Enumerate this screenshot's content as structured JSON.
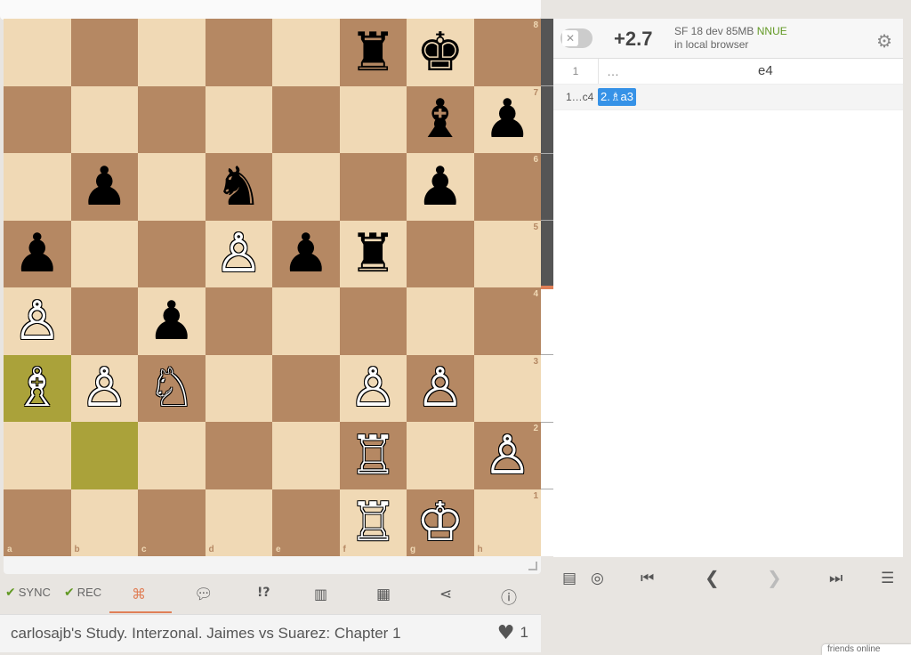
{
  "board": {
    "files": [
      "a",
      "b",
      "c",
      "d",
      "e",
      "f",
      "g",
      "h"
    ],
    "ranks": [
      "8",
      "7",
      "6",
      "5",
      "4",
      "3",
      "2",
      "1"
    ],
    "highlight_squares": [
      "a3",
      "b2"
    ],
    "colors": {
      "light": "#f0d9b5",
      "dark": "#b58863",
      "highlight": "#aaa23a"
    },
    "pieces": [
      {
        "square": "f8",
        "glyph": "♜",
        "color": "b",
        "name": "black-rook-icon"
      },
      {
        "square": "g8",
        "glyph": "♚",
        "color": "b",
        "name": "black-king-icon"
      },
      {
        "square": "g7",
        "glyph": "♝",
        "color": "b",
        "name": "black-bishop-icon"
      },
      {
        "square": "h7",
        "glyph": "♟",
        "color": "b",
        "name": "black-pawn-icon"
      },
      {
        "square": "b6",
        "glyph": "♟",
        "color": "b",
        "name": "black-pawn-icon"
      },
      {
        "square": "d6",
        "glyph": "♞",
        "color": "b",
        "name": "black-knight-icon"
      },
      {
        "square": "g6",
        "glyph": "♟",
        "color": "b",
        "name": "black-pawn-icon"
      },
      {
        "square": "a5",
        "glyph": "♟",
        "color": "b",
        "name": "black-pawn-icon"
      },
      {
        "square": "d5",
        "glyph": "♙",
        "color": "w",
        "name": "white-pawn-icon"
      },
      {
        "square": "e5",
        "glyph": "♟",
        "color": "b",
        "name": "black-pawn-icon"
      },
      {
        "square": "f5",
        "glyph": "♜",
        "color": "b",
        "name": "black-rook-icon"
      },
      {
        "square": "a4",
        "glyph": "♙",
        "color": "w",
        "name": "white-pawn-icon"
      },
      {
        "square": "c4",
        "glyph": "♟",
        "color": "b",
        "name": "black-pawn-icon"
      },
      {
        "square": "a3",
        "glyph": "♗",
        "color": "w",
        "name": "white-bishop-icon"
      },
      {
        "square": "b3",
        "glyph": "♙",
        "color": "w",
        "name": "white-pawn-icon"
      },
      {
        "square": "c3",
        "glyph": "♘",
        "color": "w",
        "name": "white-knight-icon"
      },
      {
        "square": "f3",
        "glyph": "♙",
        "color": "w",
        "name": "white-pawn-icon"
      },
      {
        "square": "g3",
        "glyph": "♙",
        "color": "w",
        "name": "white-pawn-icon"
      },
      {
        "square": "f2",
        "glyph": "♖",
        "color": "w",
        "name": "white-rook-icon"
      },
      {
        "square": "h2",
        "glyph": "♙",
        "color": "w",
        "name": "white-pawn-icon"
      },
      {
        "square": "f1",
        "glyph": "♖",
        "color": "w",
        "name": "white-rook-icon"
      },
      {
        "square": "g1",
        "glyph": "♔",
        "color": "w",
        "name": "white-king-icon"
      }
    ]
  },
  "ceval": {
    "toggle_glyph": "✕",
    "score": "+2.7",
    "engine_line1": "SF 18 dev 85MB",
    "nnue_label": "NNUE",
    "engine_line2": "in local browser",
    "settings_icon": "gear-icon"
  },
  "moves": {
    "row1": {
      "num": "1",
      "dots": "…",
      "white": "e4"
    },
    "variation": {
      "prefix": "1…c4",
      "move": "2.♗a3"
    }
  },
  "analyse_controls": {
    "icons": [
      "book-icon",
      "target-icon",
      "first-icon",
      "prev-icon",
      "next-icon",
      "last-icon",
      "menu-icon"
    ]
  },
  "tools": {
    "sync_label": "SYNC",
    "rec_label": "REC",
    "items": [
      "tag-icon",
      "comment-icon",
      "glyphs-icon",
      "chart-icon",
      "grid-icon",
      "share-icon",
      "info-icon"
    ],
    "glyph_text": "!?"
  },
  "study": {
    "title": "carlosajb's Study. Interzonal. Jaimes vs Suarez: Chapter 1",
    "likes": "1"
  },
  "friends_label": "friends online"
}
